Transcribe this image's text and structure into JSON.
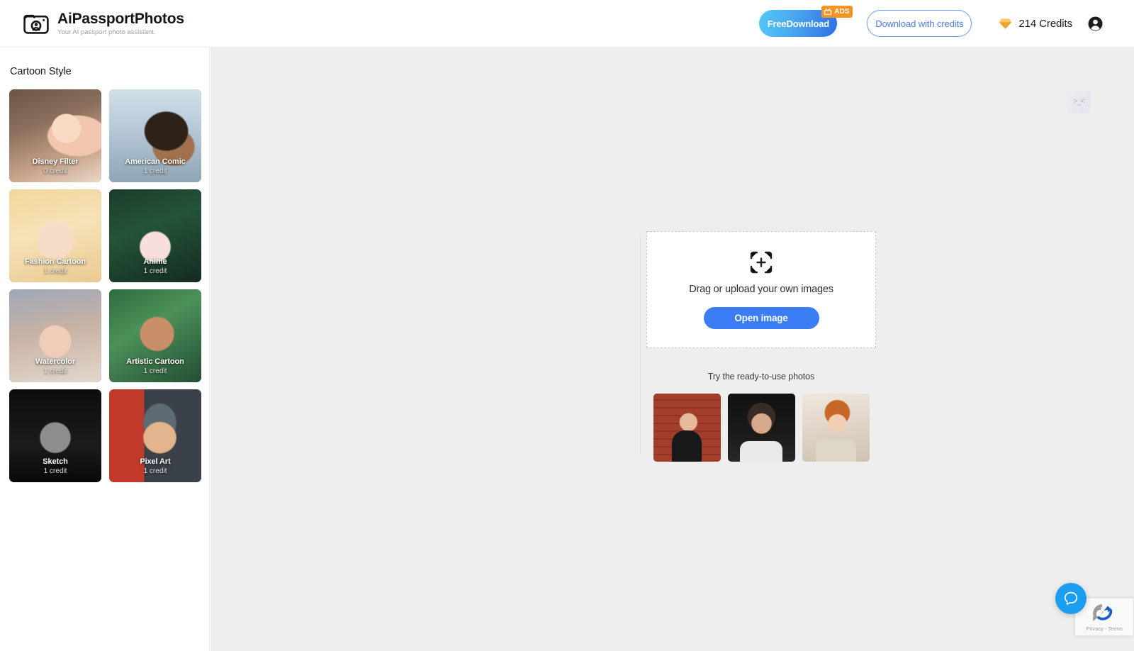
{
  "header": {
    "brand_title": "AiPassportPhotos",
    "brand_tagline": "Your AI passport photo assistant.",
    "brand_icon": "camera-icon",
    "free_download_label": "FreeDownload",
    "ads_badge_label": "ADS",
    "ads_badge_icon": "tv-ad-icon",
    "download_credits_label": "Download with credits",
    "credits_value": "214 Credits",
    "credits_icon": "gem-icon",
    "account_icon": "account-avatar-icon",
    "accent_blue": "#3b7df5",
    "accent_orange": "#f79423"
  },
  "sidebar": {
    "title": "Cartoon Style",
    "styles": [
      {
        "name": "Disney Filter",
        "credit": "0 credit",
        "art": "art-disney"
      },
      {
        "name": "American Comic",
        "credit": "1 credit",
        "art": "art-comic"
      },
      {
        "name": "Fashion Cartoon",
        "credit": "1 credit",
        "art": "art-fashion"
      },
      {
        "name": "Anime",
        "credit": "1 credit",
        "art": "art-anime"
      },
      {
        "name": "Watercolor",
        "credit": "1 credit",
        "art": "art-watercolor"
      },
      {
        "name": "Artistic Cartoon",
        "credit": "1 credit",
        "art": "art-artistic"
      },
      {
        "name": "Sketch",
        "credit": "1 credit",
        "art": "art-sketch"
      },
      {
        "name": "Pixel Art",
        "credit": "1 credit",
        "art": "art-pixel"
      }
    ]
  },
  "canvas": {
    "corner_sticker_glyph": ">_<",
    "dropzone": {
      "icon": "add-image-frame-icon",
      "label": "Drag or upload your own images",
      "button_label": "Open image"
    },
    "ready_photos": {
      "label": "Try the ready-to-use photos",
      "items": [
        {
          "alt": "woman-on-red-brick-wall",
          "art": "art-s1"
        },
        {
          "alt": "portrait-dark-background",
          "art": "art-s2"
        },
        {
          "alt": "young-man-light-interior",
          "art": "art-s3"
        }
      ]
    }
  },
  "floating": {
    "chat_icon": "chat-bubble-icon",
    "recaptcha_terms": "Privacy - Terms",
    "recaptcha_icon": "recaptcha-logo-icon"
  }
}
